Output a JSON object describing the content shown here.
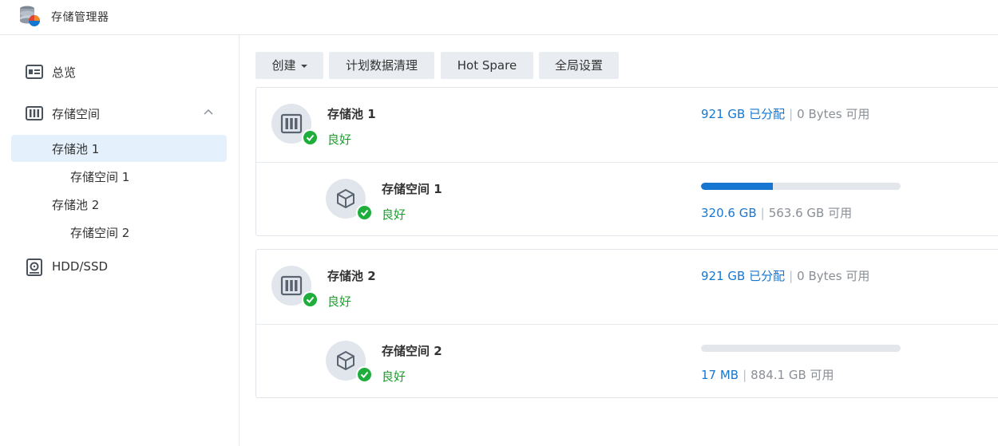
{
  "app": {
    "title": "存储管理器",
    "icon": "storage-manager-icon"
  },
  "sidebar": {
    "items": [
      {
        "label": "总览",
        "icon": "overview-icon"
      },
      {
        "label": "存储空间",
        "icon": "storage-icon",
        "expanded": true
      },
      {
        "label": "HDD/SSD",
        "icon": "drive-icon"
      }
    ],
    "sub_items": [
      {
        "label": "存储池 1",
        "active": true
      },
      {
        "label": "存储空间 1",
        "active": false
      },
      {
        "label": "存储池 2",
        "active": false
      },
      {
        "label": "存储空间 2",
        "active": false
      }
    ]
  },
  "toolbar": {
    "create_label": "创建",
    "scrub_label": "计划数据清理",
    "hotspare_label": "Hot Spare",
    "global_label": "全局设置"
  },
  "pools": [
    {
      "name": "存储池 1",
      "status": "良好",
      "allocated": "921 GB 已分配",
      "available": "0 Bytes 可用",
      "volume": {
        "name": "存储空间 1",
        "status": "良好",
        "used": "320.6 GB",
        "available": "563.6 GB 可用",
        "usage_fraction": 0.36
      }
    },
    {
      "name": "存储池 2",
      "status": "良好",
      "allocated": "921 GB 已分配",
      "available": "0 Bytes 可用",
      "volume": {
        "name": "存储空间 2",
        "status": "良好",
        "used": "17 MB",
        "available": "884.1 GB 可用",
        "usage_fraction": 0.0
      }
    }
  ],
  "colors": {
    "accent": "#1677d2",
    "success": "#1fae3c",
    "status_text": "#1a9e2c",
    "active_bg": "#e4f0fb"
  }
}
